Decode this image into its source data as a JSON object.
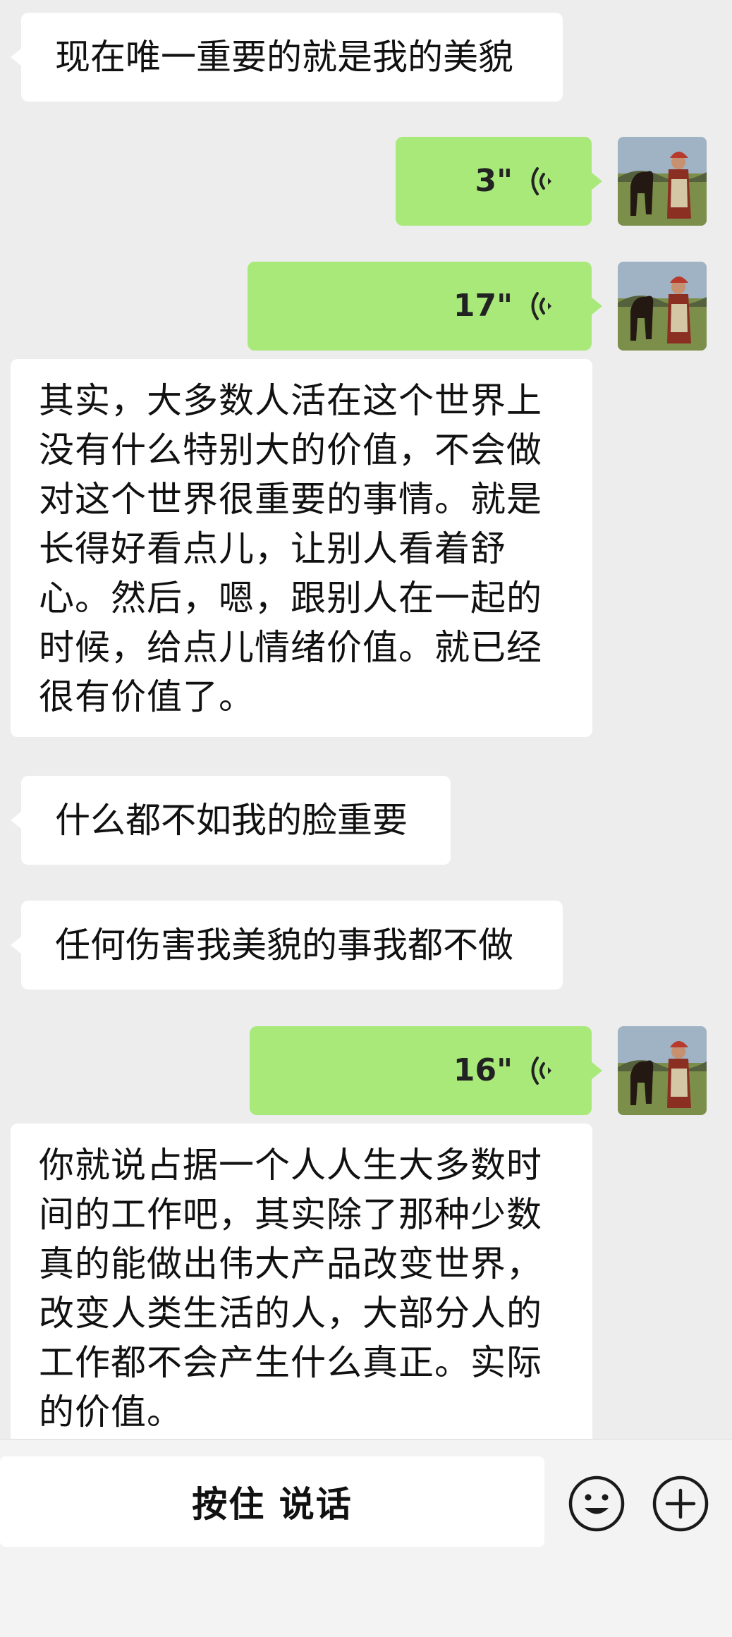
{
  "chat": {
    "messages": [
      {
        "side": "in",
        "type": "text",
        "text": "现在唯一重要的就是我的美貌"
      },
      {
        "side": "out",
        "type": "voice",
        "duration": "3\""
      },
      {
        "side": "out",
        "type": "voice",
        "duration": "17\""
      },
      {
        "side": "in",
        "type": "text",
        "lines": [
          "其实，大多数人活在这个世界上",
          "没有什么特别大的价值，不会做",
          "对这个世界很重要的事情。就是",
          "长得好看点儿，让别人看着舒",
          "心。然后，嗯，跟别人在一起的",
          "时候，给点儿情绪价值。就已经",
          "很有价值了。"
        ]
      },
      {
        "side": "in",
        "type": "text",
        "text": "什么都不如我的脸重要"
      },
      {
        "side": "in",
        "type": "text",
        "text": "任何伤害我美貌的事我都不做"
      },
      {
        "side": "out",
        "type": "voice",
        "duration": "16\""
      },
      {
        "side": "in",
        "type": "text",
        "lines": [
          "你就说占据一个人人生大多数时",
          "间的工作吧，其实除了那种少数",
          "真的能做出伟大产品改变世界，",
          "改变人类生活的人，大部分人的",
          "工作都不会产生什么真正。实际",
          "的价值。"
        ]
      }
    ]
  },
  "input_bar": {
    "talk_label": "按住 说话",
    "emoji_icon": "smiley-face-icon",
    "plus_icon": "plus-circle-icon"
  },
  "colors": {
    "background": "#ededed",
    "incoming_bubble": "#ffffff",
    "outgoing_bubble": "#a8e97a"
  }
}
